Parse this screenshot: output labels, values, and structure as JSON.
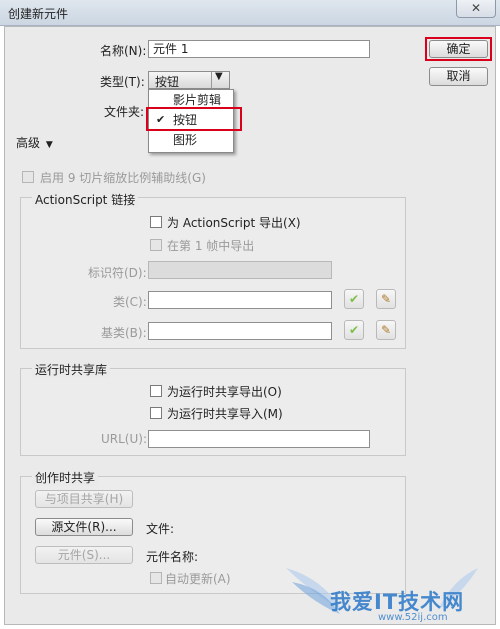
{
  "window": {
    "title": "创建新元件",
    "close_glyph": "✕"
  },
  "form": {
    "name_label": "名称(N):",
    "name_value": "元件 1",
    "type_label": "类型(T):",
    "type_value": "按钮",
    "folder_label": "文件夹:",
    "advanced_label": "高级"
  },
  "type_menu": {
    "items": [
      {
        "label": "影片剪辑",
        "checked": false
      },
      {
        "label": "按钮",
        "checked": true
      },
      {
        "label": "图形",
        "checked": false
      }
    ],
    "check_glyph": "✔"
  },
  "buttons": {
    "ok": "确定",
    "cancel": "取消"
  },
  "scale9": {
    "label": "启用 9 切片缩放比例辅助线(G)",
    "checked": false,
    "enabled": false
  },
  "actionscript": {
    "heading": "ActionScript 链接",
    "export_as": "为 ActionScript 导出(X)",
    "export_first_frame": "在第 1 帧中导出",
    "identifier_label": "标识符(D):",
    "class_label": "类(C):",
    "class_value": "",
    "base_class_label": "基类(B):",
    "base_class_value": ""
  },
  "runtime_shared": {
    "heading": "运行时共享库",
    "export_runtime": "为运行时共享导出(O)",
    "import_runtime": "为运行时共享导入(M)",
    "url_label": "URL(U):",
    "url_value": ""
  },
  "authoring_shared": {
    "heading": "创作时共享",
    "share_with_project": "与项目共享(H)",
    "source_file_button": "源文件(R)...",
    "file_label": "文件:",
    "symbol_button": "元件(S)...",
    "symbol_name_label": "元件名称:",
    "auto_update": "自动更新(A)"
  },
  "watermark": {
    "text": "我爱IT技术网",
    "url": "www.52ij.com"
  },
  "colors": {
    "highlight_red": "#d9001b",
    "watermark_blue": "#2a78c8"
  }
}
